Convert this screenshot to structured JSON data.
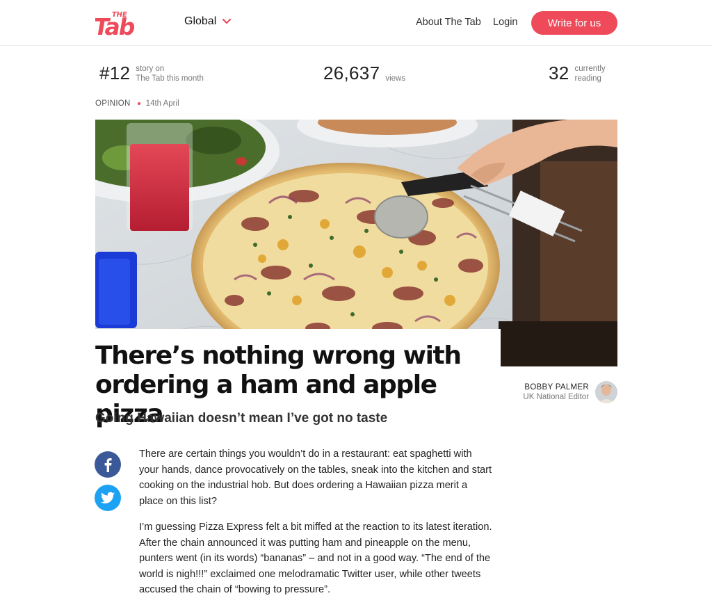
{
  "brand": {
    "logo_text": "The Tab",
    "logo_top": "THE",
    "logo_main": "Tab"
  },
  "header": {
    "edition": "Global",
    "nav": {
      "about": "About The Tab",
      "login": "Login"
    },
    "cta": "Write for us"
  },
  "stats": {
    "rank": {
      "value": "#12",
      "label_line1": "story on",
      "label_line2": "The Tab this month"
    },
    "views": {
      "value": "26,637",
      "label": "views"
    },
    "reading": {
      "value": "32",
      "label_line1": "currently",
      "label_line2": "reading"
    }
  },
  "article": {
    "category": "OPINION",
    "date": "14th April",
    "title": "There’s nothing wrong with ordering a ham and apple pizza",
    "subtitle": "Going Hawaiian doesn’t mean I’ve got no taste",
    "author": {
      "name": "BOBBY PALMER",
      "role": "UK National Editor"
    },
    "paragraphs": [
      "There are certain things you wouldn’t do in a restaurant: eat spaghetti with your hands, dance provocatively on the tables, sneak into the kitchen and start cooking on the industrial hob. But does ordering a Hawaiian pizza merit a place on this list?",
      "I’m guessing Pizza Express felt a bit miffed at the reaction to its latest iteration. After the chain announced it was putting ham and pineapple on the menu, punters went (in its words) “bananas” – and not in a good way. “The end of the world is nigh!!!” exclaimed one melodramatic Twitter user, while other tweets accused the chain of “bowing to pressure”."
    ]
  },
  "share": {
    "facebook_icon": "facebook-icon",
    "twitter_icon": "twitter-icon"
  },
  "colors": {
    "accent": "#ee4a5a",
    "facebook": "#3b5998",
    "twitter": "#1da1f2"
  }
}
